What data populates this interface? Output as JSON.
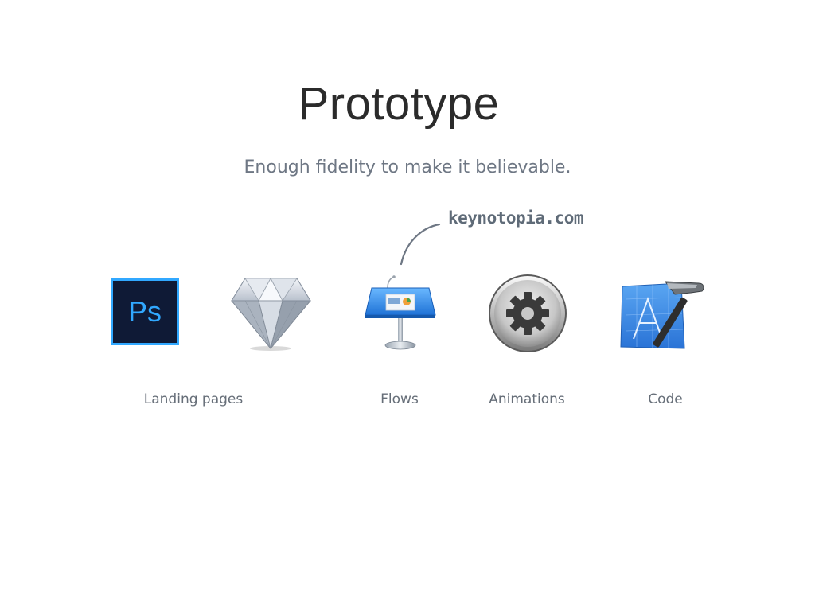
{
  "slide": {
    "title": "Prototype",
    "subtitle": "Enough fidelity to make it believable.",
    "callout": "keynotopia.com"
  },
  "icons": [
    {
      "name": "photoshop-icon",
      "text": "Ps"
    },
    {
      "name": "sketch-icon"
    },
    {
      "name": "keynote-icon"
    },
    {
      "name": "gear-icon"
    },
    {
      "name": "xcode-icon"
    }
  ],
  "labels": {
    "landing": "Landing pages",
    "flows": "Flows",
    "animations": "Animations",
    "code": "Code"
  },
  "colors": {
    "title": "#2b2b2b",
    "subtitle": "#6e7784",
    "label": "#666e78",
    "photoshop_bg": "#0f1a36",
    "photoshop_accent": "#31a8ff",
    "xcode_blue": "#2f7fe0"
  }
}
